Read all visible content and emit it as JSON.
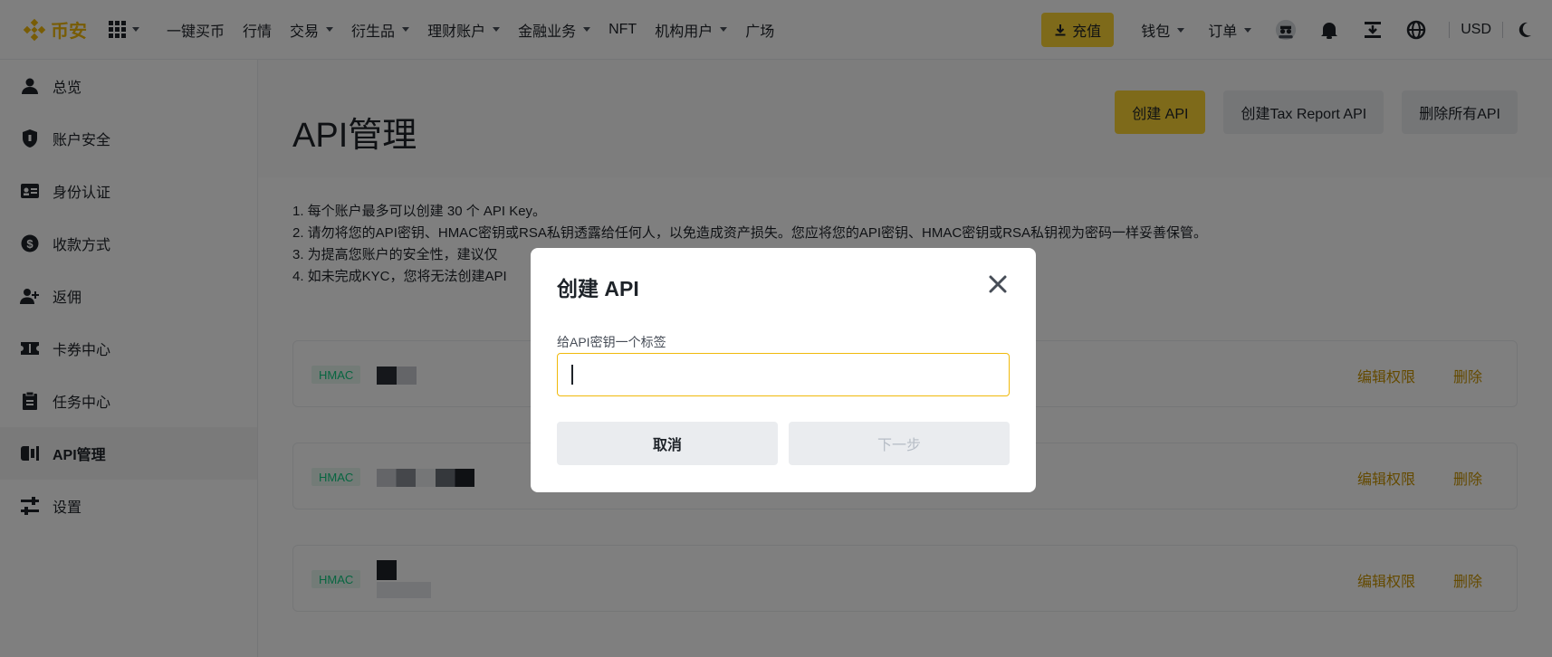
{
  "brand": {
    "name": "币安",
    "accent": "#f0b90b"
  },
  "nav": {
    "items": [
      "一键买币",
      "行情",
      "交易",
      "衍生品",
      "理财账户",
      "金融业务",
      "NFT",
      "机构用户",
      "广场"
    ],
    "deposit_label": "充值",
    "wallet_label": "钱包",
    "orders_label": "订单",
    "currency": "USD"
  },
  "sidebar": {
    "items": [
      "总览",
      "账户安全",
      "身份认证",
      "收款方式",
      "返佣",
      "卡券中心",
      "任务中心",
      "API管理",
      "设置"
    ],
    "active": "API管理"
  },
  "page": {
    "title": "API管理",
    "create_api": "创建 API",
    "create_tax_api": "创建Tax Report API",
    "delete_all": "删除所有API",
    "notes": [
      "1. 每个账户最多可以创建 30 个 API Key。",
      "2. 请勿将您的API密钥、HMAC密钥或RSA私钥透露给任何人，以免造成资产损失。您应将您的API密钥、HMAC密钥或RSA私钥视为密码一样妥善保管。",
      "3. 为提高您账户的安全性，建议仅",
      "4. 如未完成KYC，您将无法创建API"
    ],
    "rows": [
      {
        "tag": "HMAC",
        "edit": "编辑权限",
        "delete": "删除"
      },
      {
        "tag": "HMAC",
        "edit": "编辑权限",
        "delete": "删除"
      },
      {
        "tag": "HMAC",
        "edit": "编辑权限",
        "delete": "删除"
      }
    ]
  },
  "modal": {
    "title": "创建 API",
    "label": "给API密钥一个标签",
    "value": "",
    "cancel": "取消",
    "next": "下一步"
  }
}
